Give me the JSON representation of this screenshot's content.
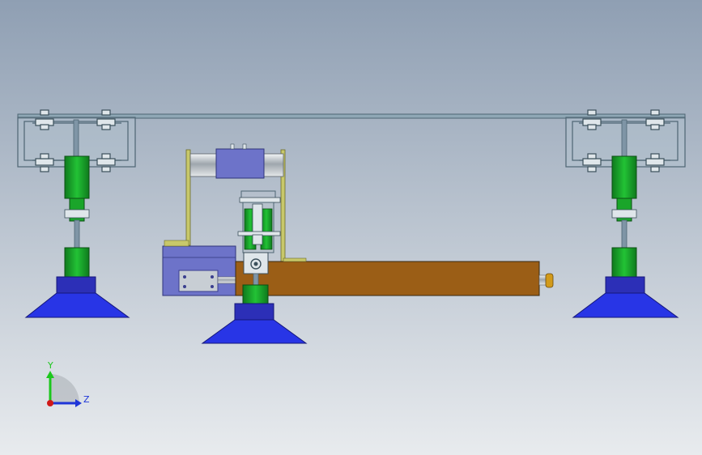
{
  "viewport": {
    "background_top": "#8f9fb3",
    "background_bottom": "#e8ebee"
  },
  "palette": {
    "frame": "#5d7a89",
    "frame_fill": "#a9bdc9",
    "rail": "#8fa7b5",
    "cylinder_green": "#1aa52a",
    "cylinder_dark": "#0f6f1a",
    "collar_blue": "#2c2fb7",
    "cup_blue": "#2835e6",
    "rod": "#7f95a6",
    "slide_body": "#9b5e16",
    "slide_edge": "#3a2a12",
    "motor_blue": "#6d73c9",
    "motor_dark": "#3a3f8f",
    "bracket": "#c8c86a",
    "silver": "#c8ced4",
    "knob": "#d29a1a"
  },
  "triad": {
    "y_label": "Y",
    "z_label": "Z",
    "y_color": "#1cc71c",
    "z_color": "#1e35d8",
    "origin_color": "#d01818"
  }
}
